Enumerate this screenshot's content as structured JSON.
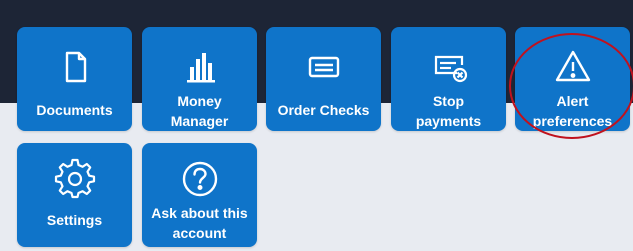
{
  "tiles_row1": [
    {
      "label_line1": "Documents",
      "label_line2": "",
      "icon": "document-icon"
    },
    {
      "label_line1": "Money",
      "label_line2": "Manager",
      "icon": "bar-chart-icon"
    },
    {
      "label_line1": "Order Checks",
      "label_line2": "",
      "icon": "check-card-icon"
    },
    {
      "label_line1": "Stop",
      "label_line2": "payments",
      "icon": "stop-payment-icon"
    },
    {
      "label_line1": "Alert",
      "label_line2": "preferences",
      "icon": "warning-triangle-icon"
    }
  ],
  "tiles_row2": [
    {
      "label_line1": "Settings",
      "label_line2": "",
      "icon": "gear-icon"
    },
    {
      "label_line1": "Ask about this",
      "label_line2": "account",
      "icon": "question-circle-icon"
    }
  ],
  "colors": {
    "tile_background": "#0f74c9",
    "tile_text": "#ffffff",
    "top_band": "#1d2536",
    "page_background": "#e8ebf1",
    "highlight_annotation": "#c0121e"
  },
  "annotation": {
    "shape": "ellipse",
    "target": "Alert preferences tile"
  }
}
